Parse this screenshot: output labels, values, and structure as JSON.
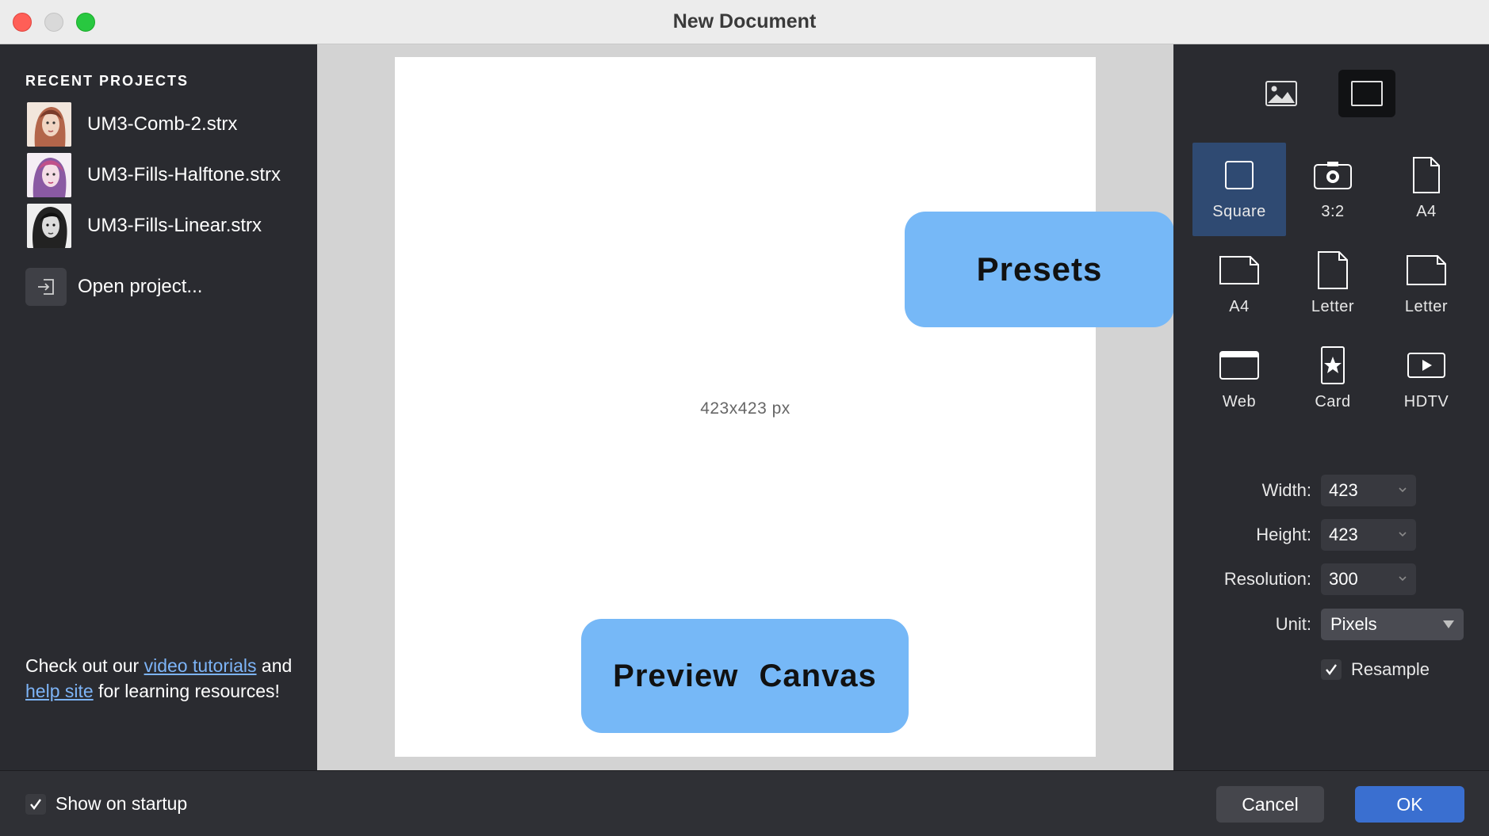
{
  "window": {
    "title": "New Document"
  },
  "sidebar": {
    "recent_heading": "RECENT PROJECTS",
    "projects": [
      {
        "name": "UM3-Comb-2.strx"
      },
      {
        "name": "UM3-Fills-Halftone.strx"
      },
      {
        "name": "UM3-Fills-Linear.strx"
      }
    ],
    "open_label": "Open project...",
    "help": {
      "prefix": "Check out our ",
      "link1": "video tutorials",
      "mid": " and ",
      "link2": "help site",
      "suffix": " for learning resources!"
    }
  },
  "preview": {
    "size_label": "423x423 px",
    "callout_canvas": "Preview Canvas",
    "callout_presets": "Presets"
  },
  "presets": [
    {
      "label": "Square",
      "icon": "square-icon",
      "selected": true
    },
    {
      "label": "3:2",
      "icon": "camera-icon",
      "selected": false
    },
    {
      "label": "A4",
      "icon": "portrait-page-icon",
      "selected": false
    },
    {
      "label": "A4",
      "icon": "landscape-page-icon",
      "selected": false
    },
    {
      "label": "Letter",
      "icon": "portrait-page-icon",
      "selected": false
    },
    {
      "label": "Letter",
      "icon": "landscape-page-icon",
      "selected": false
    },
    {
      "label": "Web",
      "icon": "browser-window-icon",
      "selected": false
    },
    {
      "label": "Card",
      "icon": "star-card-icon",
      "selected": false
    },
    {
      "label": "HDTV",
      "icon": "play-screen-icon",
      "selected": false
    }
  ],
  "fields": {
    "width_label": "Width:",
    "width_value": "423",
    "height_label": "Height:",
    "height_value": "423",
    "resolution_label": "Resolution:",
    "resolution_value": "300",
    "unit_label": "Unit:",
    "unit_value": "Pixels",
    "resample_label": "Resample",
    "resample_checked": true
  },
  "footer": {
    "show_on_startup": "Show on startup",
    "show_on_startup_checked": true,
    "cancel": "Cancel",
    "ok": "OK"
  },
  "colors": {
    "accent": "#3a6fd0",
    "callout": "#76b8f7",
    "selected_preset": "#2f4a72"
  }
}
